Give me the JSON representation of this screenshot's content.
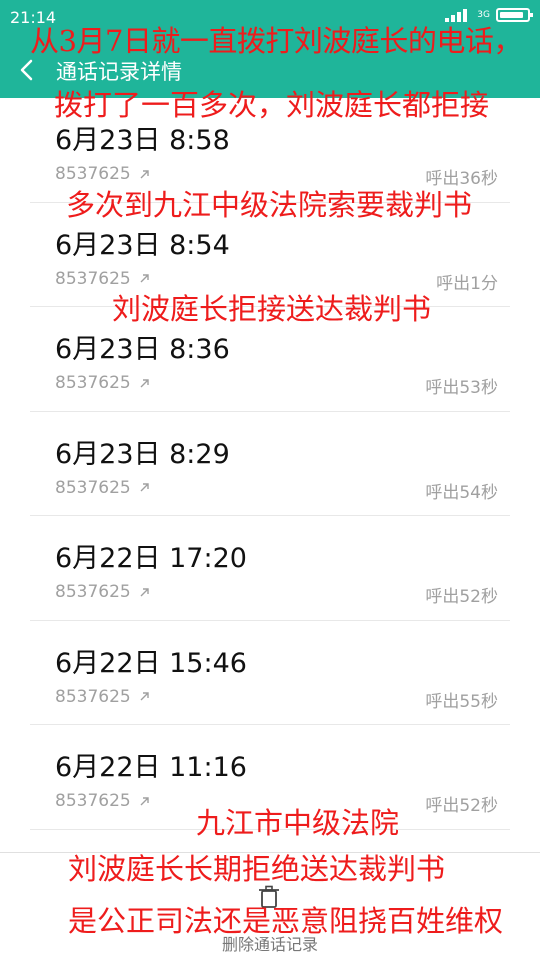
{
  "status_bar": {
    "time": "21:14",
    "network": "3G",
    "battery_level": 0.9
  },
  "header": {
    "title": "通话记录详情"
  },
  "calls": [
    {
      "date": "6月23日 8:58",
      "number": "8537625",
      "duration": "呼出36秒"
    },
    {
      "date": "6月23日 8:54",
      "number": "8537625",
      "duration": "呼出1分"
    },
    {
      "date": "6月23日 8:36",
      "number": "8537625",
      "duration": "呼出53秒"
    },
    {
      "date": "6月23日 8:29",
      "number": "8537625",
      "duration": "呼出54秒"
    },
    {
      "date": "6月22日 17:20",
      "number": "8537625",
      "duration": "呼出52秒"
    },
    {
      "date": "6月22日 15:46",
      "number": "8537625",
      "duration": "呼出55秒"
    },
    {
      "date": "6月22日 11:16",
      "number": "8537625",
      "duration": "呼出52秒"
    }
  ],
  "bottom": {
    "delete_label": "删除通话记录"
  },
  "overlay_captions": [
    "从3月7日就一直拨打刘波庭长的电话，",
    "拨打了一百多次，刘波庭长都拒接",
    "多次到九江中级法院索要裁判书",
    "刘波庭长拒接送达裁判书",
    "九江市中级法院",
    "刘波庭长长期拒绝送达裁判书",
    "是公正司法还是恶意阻挠百姓维权"
  ],
  "colors": {
    "header": "#1fb59a",
    "caption": "#ee1c1c"
  }
}
